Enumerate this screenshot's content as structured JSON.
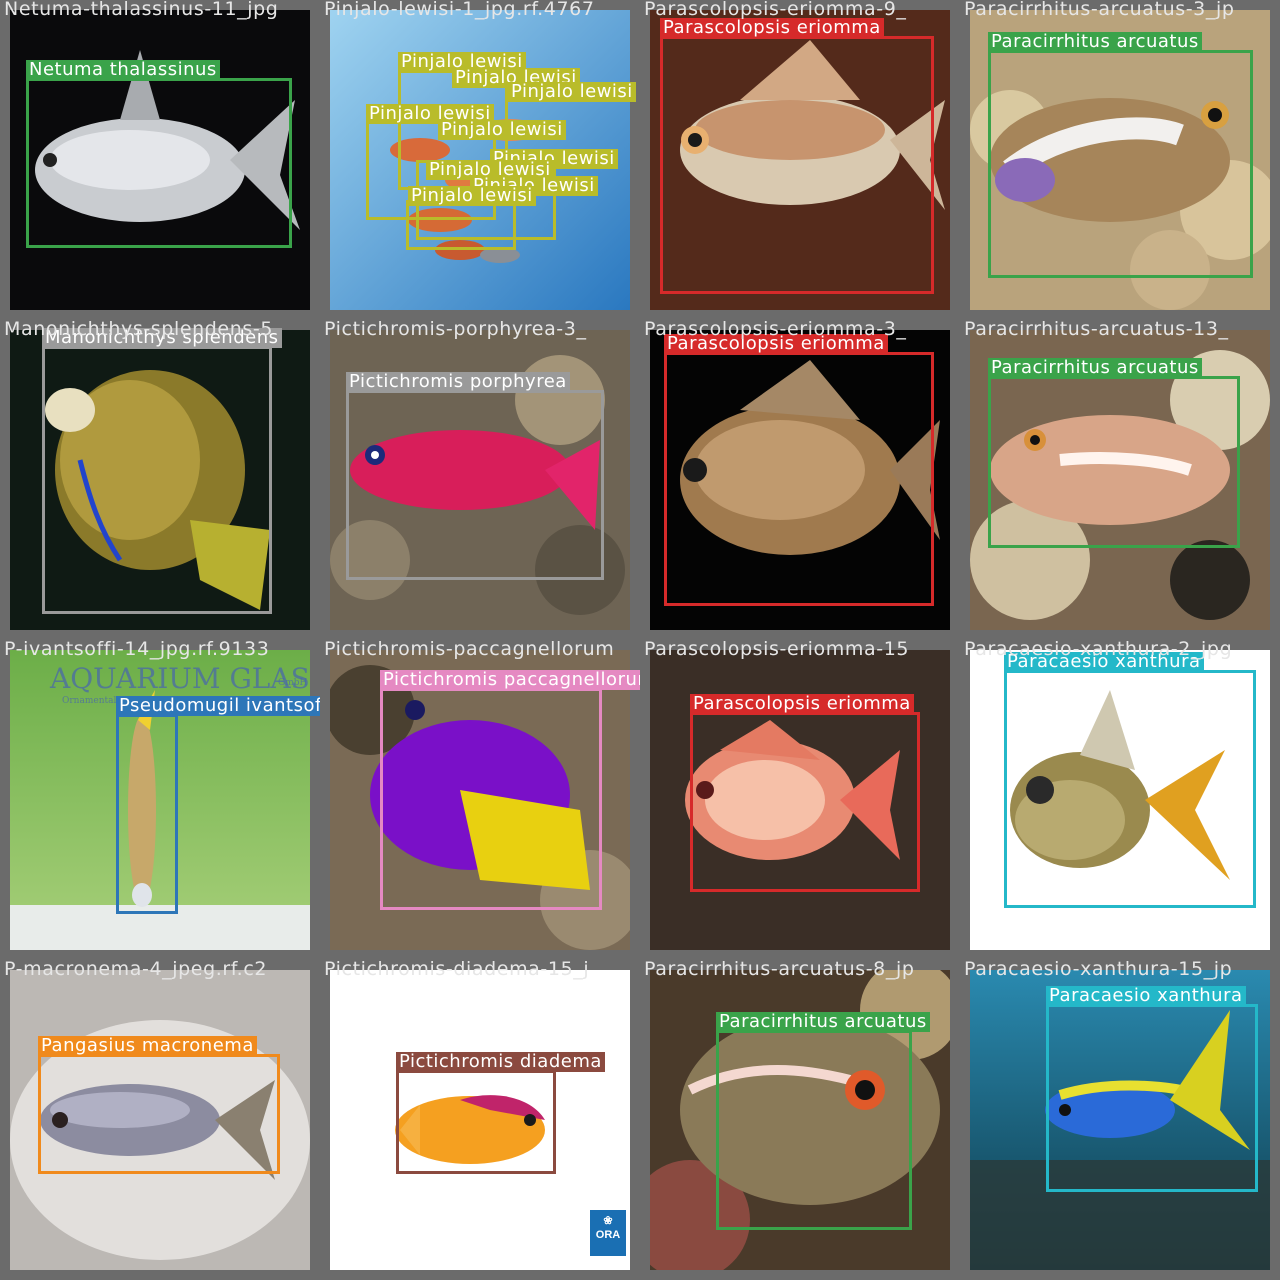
{
  "tiles": [
    {
      "filename": "Netuma-thalassinus-11_jpg",
      "scene": "dark",
      "detections": [
        {
          "label": "Netuma thalassinus",
          "color": "#3aa34a"
        }
      ]
    },
    {
      "filename": "Pinjalo-lewisi-1_jpg.rf.4767",
      "scene": "blue",
      "detections": [
        {
          "label": "Pinjalo lewisi",
          "color": "#b9bc2a"
        },
        {
          "label": "Pinjalo lewisi",
          "color": "#b9bc2a"
        },
        {
          "label": "Pinjalo lewisi",
          "color": "#b9bc2a"
        },
        {
          "label": "Pinjalo lewisi",
          "color": "#b9bc2a"
        },
        {
          "label": "Pinjalo lewisi",
          "color": "#b9bc2a"
        },
        {
          "label": "Pinjalo lewisi",
          "color": "#b9bc2a"
        },
        {
          "label": "Pinjalo lewisi",
          "color": "#b9bc2a"
        },
        {
          "label": "Pinjalo lewisi",
          "color": "#b9bc2a"
        },
        {
          "label": "Pinjalo lewisi",
          "color": "#b9bc2a"
        }
      ]
    },
    {
      "filename": "Parascolopsis-eriomma-9_",
      "scene": "wood",
      "detections": [
        {
          "label": "Parascolopsis eriomma",
          "color": "#d62a2a"
        }
      ]
    },
    {
      "filename": "Paracirrhitus-arcuatus-3_jp",
      "scene": "coral",
      "detections": [
        {
          "label": "Paracirrhitus arcuatus",
          "color": "#3aa34a"
        }
      ]
    },
    {
      "filename": "Manonichthys-splendens-5",
      "scene": "darkgreen",
      "detections": [
        {
          "label": "Manonichthys splendens",
          "color": "#9a9a9a"
        }
      ]
    },
    {
      "filename": "Pictichromis-porphyrea-3_",
      "scene": "rock",
      "detections": [
        {
          "label": "Pictichromis porphyrea",
          "color": "#9a9a9a"
        }
      ]
    },
    {
      "filename": "Parascolopsis-eriomma-3_",
      "scene": "dark",
      "detections": [
        {
          "label": "Parascolopsis eriomma",
          "color": "#d62a2a"
        }
      ]
    },
    {
      "filename": "Paracirrhitus-arcuatus-13_",
      "scene": "coral",
      "detections": [
        {
          "label": "Paracirrhitus arcuatus",
          "color": "#3aa34a"
        }
      ]
    },
    {
      "filename": "P-ivantsoffi-14_jpg.rf.9133",
      "scene": "aquarium",
      "logo_text": "AQUARIUM GLASER",
      "logo_sub": "Ornamental Fish",
      "logo_gmbh": "GmbH",
      "detections": [
        {
          "label": "Pseudomugil ivantsoffi",
          "color": "#2d76b8"
        }
      ]
    },
    {
      "filename": "Pictichromis-paccagnellorum",
      "scene": "rock",
      "detections": [
        {
          "label": "Pictichromis paccagnellorum",
          "color": "#e589c2"
        }
      ]
    },
    {
      "filename": "Parascolopsis-eriomma-15",
      "scene": "darkbrown",
      "detections": [
        {
          "label": "Parascolopsis eriomma",
          "color": "#d62a2a"
        }
      ]
    },
    {
      "filename": "Paracaesio-xanthura-2_jpg",
      "scene": "white",
      "detections": [
        {
          "label": "Paracaesio xanthura",
          "color": "#24b8c9"
        }
      ]
    },
    {
      "filename": "P-macronema-4_jpeg.rf.c2",
      "scene": "grey",
      "detections": [
        {
          "label": "Pangasius macronema",
          "color": "#f08a1c"
        }
      ]
    },
    {
      "filename": "Pictichromis-diadema-15_j",
      "scene": "white",
      "ora_text": "ORA",
      "detections": [
        {
          "label": "Pictichromis diadema",
          "color": "#8b4a3f"
        }
      ]
    },
    {
      "filename": "Paracirrhitus-arcuatus-8_jp",
      "scene": "coral2",
      "detections": [
        {
          "label": "Paracirrhitus arcuatus",
          "color": "#3aa34a"
        }
      ]
    },
    {
      "filename": "Paracaesio-xanthura-15_jp",
      "scene": "ocean",
      "detections": [
        {
          "label": "Paracaesio xanthura",
          "color": "#24b8c9"
        }
      ]
    }
  ]
}
